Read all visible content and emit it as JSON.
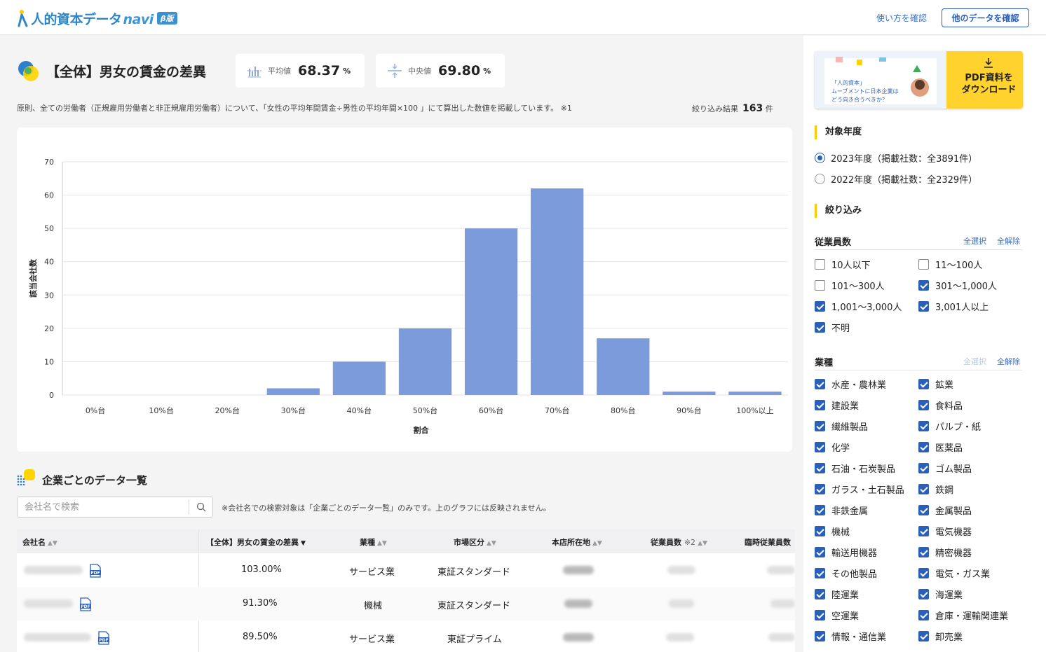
{
  "header": {
    "logo_text": "人的資本データ",
    "logo_navi": "navi",
    "beta_badge": "β版",
    "howto_link": "使い方を確認",
    "other_data_button": "他のデータを確認"
  },
  "page": {
    "title": "【全体】男女の賃金の差異",
    "avg_label": "平均値",
    "avg_value": "68.37",
    "avg_unit": "%",
    "median_label": "中央値",
    "median_value": "69.80",
    "median_unit": "%",
    "description": "原則、全ての労働者（正規雇用労働者と非正規雇用労働者）について、「女性の平均年間賃金÷男性の平均年間×100 」にて算出した数値を掲載しています。 ※1",
    "result_label": "絞り込み結果",
    "result_count": "163",
    "result_unit": "件"
  },
  "chart_data": {
    "type": "bar",
    "categories": [
      "0%台",
      "10%台",
      "20%台",
      "30%台",
      "40%台",
      "50%台",
      "60%台",
      "70%台",
      "80%台",
      "90%台",
      "100%以上"
    ],
    "values": [
      0,
      0,
      0,
      2,
      10,
      20,
      50,
      62,
      17,
      1,
      1
    ],
    "yticks": [
      0,
      10,
      20,
      30,
      40,
      50,
      60,
      70
    ],
    "ylim": [
      0,
      70
    ],
    "xlabel": "割合",
    "ylabel": "該当会社数",
    "bar_color": "#7b9bdb",
    "grid": true
  },
  "list": {
    "title": "企業ごとのデータ一覧",
    "search_placeholder": "会社名で検索",
    "search_note": "※会社名での検索対象は「企業ごとのデータ一覧」のみです。上のグラフには反映されません。",
    "columns": [
      "会社名",
      "【全体】男女の賃金の差異",
      "業種",
      "市場区分",
      "本店所在地",
      "従業員数",
      "※2",
      "臨時従業員数"
    ],
    "rows": [
      {
        "value": "103.00%",
        "industry": "サービス業",
        "market": "東証スタンダード"
      },
      {
        "value": "91.30%",
        "industry": "機械",
        "market": "東証スタンダード"
      },
      {
        "value": "89.50%",
        "industry": "サービス業",
        "market": "東証プライム"
      }
    ]
  },
  "sidebar": {
    "banner_line1": "「人的資本」",
    "banner_line2": "ムーブメントに日本企業は",
    "banner_line3": "どう向き合うべきか？",
    "banner_cta_line1": "PDF資料を",
    "banner_cta_line2": "ダウンロード",
    "year_title": "対象年度",
    "years": [
      {
        "label": "2023年度（掲載社数：全3891件）",
        "selected": true
      },
      {
        "label": "2022年度（掲載社数：全2329件）",
        "selected": false
      }
    ],
    "filter_title": "絞り込み",
    "select_all": "全選択",
    "clear_all": "全解除",
    "employees_title": "従業員数",
    "employees": [
      {
        "label": "10人以下",
        "checked": false
      },
      {
        "label": "11〜100人",
        "checked": false
      },
      {
        "label": "101〜300人",
        "checked": false
      },
      {
        "label": "301〜1,000人",
        "checked": true
      },
      {
        "label": "1,001〜3,000人",
        "checked": true
      },
      {
        "label": "3,001人以上",
        "checked": true
      },
      {
        "label": "不明",
        "checked": true
      }
    ],
    "industry_title": "業種",
    "industries": [
      {
        "label": "水産・農林業",
        "checked": true
      },
      {
        "label": "鉱業",
        "checked": true
      },
      {
        "label": "建設業",
        "checked": true
      },
      {
        "label": "食料品",
        "checked": true
      },
      {
        "label": "繊維製品",
        "checked": true
      },
      {
        "label": "パルプ・紙",
        "checked": true
      },
      {
        "label": "化学",
        "checked": true
      },
      {
        "label": "医薬品",
        "checked": true
      },
      {
        "label": "石油・石炭製品",
        "checked": true
      },
      {
        "label": "ゴム製品",
        "checked": true
      },
      {
        "label": "ガラス・土石製品",
        "checked": true
      },
      {
        "label": "鉄鋼",
        "checked": true
      },
      {
        "label": "非鉄金属",
        "checked": true
      },
      {
        "label": "金属製品",
        "checked": true
      },
      {
        "label": "機械",
        "checked": true
      },
      {
        "label": "電気機器",
        "checked": true
      },
      {
        "label": "輸送用機器",
        "checked": true
      },
      {
        "label": "精密機器",
        "checked": true
      },
      {
        "label": "その他製品",
        "checked": true
      },
      {
        "label": "電気・ガス業",
        "checked": true
      },
      {
        "label": "陸運業",
        "checked": true
      },
      {
        "label": "海運業",
        "checked": true
      },
      {
        "label": "空運業",
        "checked": true
      },
      {
        "label": "倉庫・運輸関連業",
        "checked": true
      },
      {
        "label": "情報・通信業",
        "checked": true
      },
      {
        "label": "卸売業",
        "checked": true
      }
    ]
  }
}
